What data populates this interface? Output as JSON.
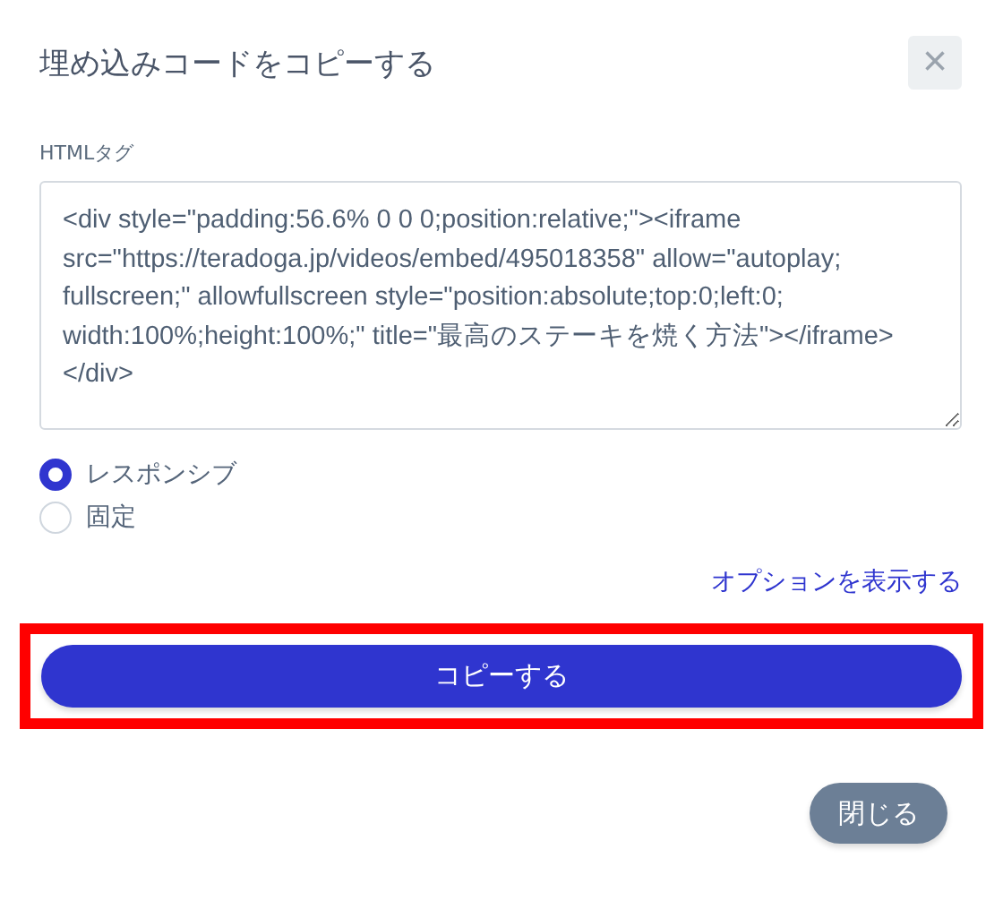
{
  "dialog": {
    "title": "埋め込みコードをコピーする",
    "close_icon": "×"
  },
  "code_field": {
    "label": "HTMLタグ",
    "value": "<div style=\"padding:56.6% 0 0 0;position:relative;\"><iframe src=\"https://teradoga.jp/videos/embed/495018358\" allow=\"autoplay; fullscreen;\" allowfullscreen style=\"position:absolute;top:0;left:0; width:100%;height:100%;\" title=\"最高のステーキを焼く方法\"></iframe></div>"
  },
  "size_options": [
    {
      "label": "レスポンシブ",
      "selected": true
    },
    {
      "label": "固定",
      "selected": false
    }
  ],
  "options_link": "オプションを表示する",
  "copy_button": {
    "label": "コピーする",
    "highlighted": true
  },
  "close_button": "閉じる"
}
